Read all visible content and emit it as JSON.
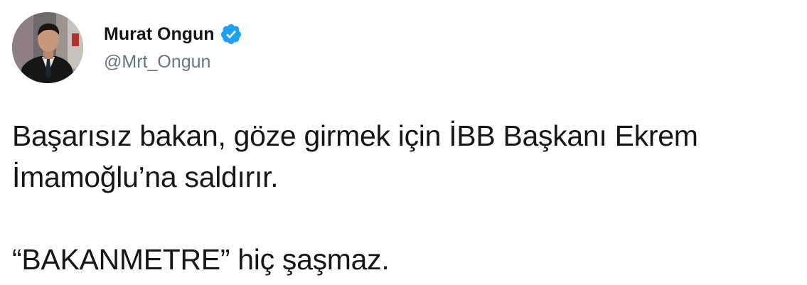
{
  "tweet": {
    "author": {
      "display_name": "Murat Ongun",
      "handle": "@Mrt_Ongun",
      "verified_icon": "verified-badge-icon",
      "avatar": "avatar"
    },
    "text": {
      "line1": "Başarısız bakan, göze girmek için İBB Başkanı Ekrem",
      "line2": "İmamoğlu’na saldırır.",
      "line3": "“BAKANMETRE” hiç şaşmaz."
    }
  },
  "colors": {
    "text": "#14171a",
    "secondary": "#657786",
    "verified_blue": "#1da1f2",
    "background": "#ffffff"
  }
}
